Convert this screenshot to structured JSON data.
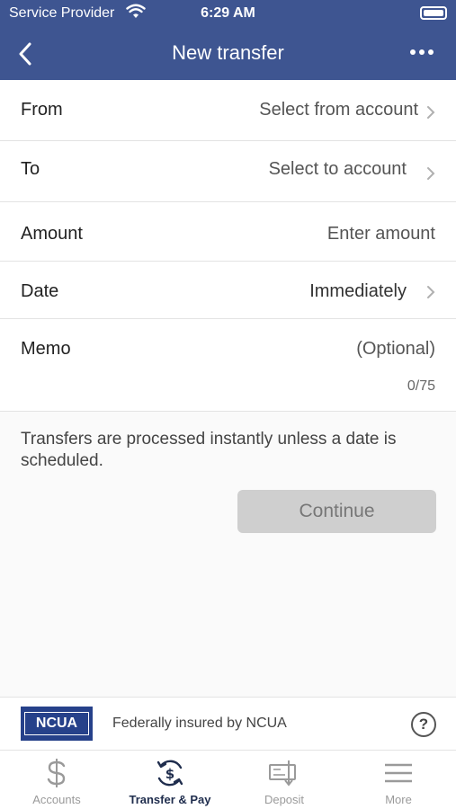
{
  "status_bar": {
    "carrier": "Service Provider",
    "time": "6:29 AM"
  },
  "navbar": {
    "title": "New transfer",
    "back_icon": "chevron-left-icon",
    "more_icon": "more-dots-icon"
  },
  "form": {
    "from": {
      "label": "From",
      "value": "Select from account"
    },
    "to": {
      "label": "To",
      "value": "Select to account"
    },
    "amount": {
      "label": "Amount",
      "placeholder": "Enter amount"
    },
    "date": {
      "label": "Date",
      "value": "Immediately"
    },
    "memo": {
      "label": "Memo",
      "placeholder": "(Optional)",
      "counter": "0/75"
    }
  },
  "info": {
    "text": "Transfers are processed instantly unless a date is scheduled.",
    "continue_label": "Continue"
  },
  "ncua": {
    "logo_text": "NCUA",
    "text": "Federally insured by NCUA",
    "help_label": "?"
  },
  "tabs": [
    {
      "label": "Accounts",
      "icon": "dollar-icon",
      "active": false
    },
    {
      "label": "Transfer & Pay",
      "icon": "transfer-pay-icon",
      "active": true
    },
    {
      "label": "Deposit",
      "icon": "check-deposit-icon",
      "active": false
    },
    {
      "label": "More",
      "icon": "menu-icon",
      "active": false
    }
  ],
  "colors": {
    "header": "#3e5591",
    "active_tab": "#1f2d4d",
    "inactive_tab": "#9a9a9a",
    "button_disabled": "#cfcfcf",
    "ncua_blue": "#26418a"
  }
}
